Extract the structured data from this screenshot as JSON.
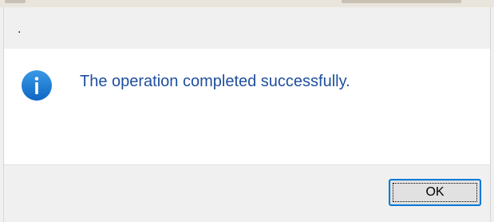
{
  "dialog": {
    "title": ".",
    "message": "The operation completed successfully.",
    "icon": "info-icon",
    "ok_label": "OK",
    "colors": {
      "message": "#1f4e9e",
      "icon": "#1778d2",
      "button_border": "#0078d7"
    }
  }
}
